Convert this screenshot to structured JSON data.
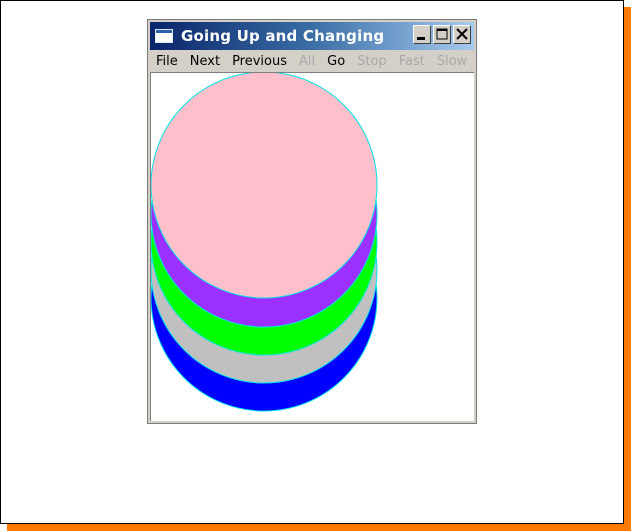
{
  "window": {
    "title": "Going Up and Changing",
    "title_icon": "window-icon",
    "controls": {
      "minimize_icon": "minimize-icon",
      "maximize_icon": "maximize-icon",
      "close_icon": "close-icon"
    }
  },
  "menu": {
    "items": [
      {
        "label": "File",
        "enabled": true
      },
      {
        "label": "Next",
        "enabled": true
      },
      {
        "label": "Previous",
        "enabled": true
      },
      {
        "label": "All",
        "enabled": false
      },
      {
        "label": "Go",
        "enabled": true
      },
      {
        "label": "Stop",
        "enabled": false
      },
      {
        "label": "Fast",
        "enabled": false
      },
      {
        "label": "Slow",
        "enabled": false
      }
    ]
  },
  "colors": {
    "frame_shadow": "#ff7a00",
    "titlebar_start": "#0a246a",
    "titlebar_end": "#a6caf0",
    "circle_outline": "#00e5e5",
    "circles_back_to_front": [
      "#0000ff",
      "#c0c0c0",
      "#00ff00",
      "#9b30ff",
      "#ffc0cb"
    ]
  }
}
